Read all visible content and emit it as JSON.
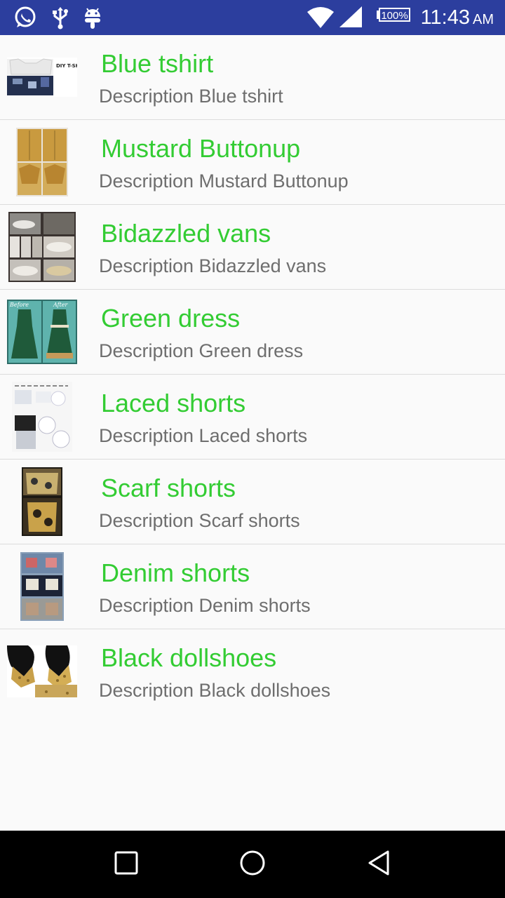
{
  "status_bar": {
    "time": "11:43",
    "ampm": "AM",
    "battery": "100%",
    "icons": [
      "whatsapp-icon",
      "usb-icon",
      "android-icon",
      "wifi-icon",
      "cell-signal-icon",
      "battery-icon"
    ],
    "background": "#2c3e9e"
  },
  "items": [
    {
      "title": "Blue tshirt",
      "description": "Description Blue tshirt",
      "thumb_label": "DIY T-SHIRT UPCYCLING"
    },
    {
      "title": "Mustard Buttonup",
      "description": "Description Mustard Buttonup"
    },
    {
      "title": "Bidazzled vans",
      "description": "Description Bidazzled vans"
    },
    {
      "title": "Green dress",
      "description": "Description Green dress",
      "thumb_before": "Before",
      "thumb_after": "After"
    },
    {
      "title": "Laced shorts",
      "description": "Description Laced shorts"
    },
    {
      "title": "Scarf shorts",
      "description": "Description Scarf shorts"
    },
    {
      "title": "Denim shorts",
      "description": "Description Denim shorts"
    },
    {
      "title": "Black dollshoes",
      "description": "Description Black dollshoes"
    }
  ],
  "colors": {
    "title": "#33cc33",
    "description": "#6e6e6e",
    "divider": "#dcdcdc"
  },
  "nav": {
    "buttons": [
      "recents-square-icon",
      "home-circle-icon",
      "back-triangle-icon"
    ]
  }
}
